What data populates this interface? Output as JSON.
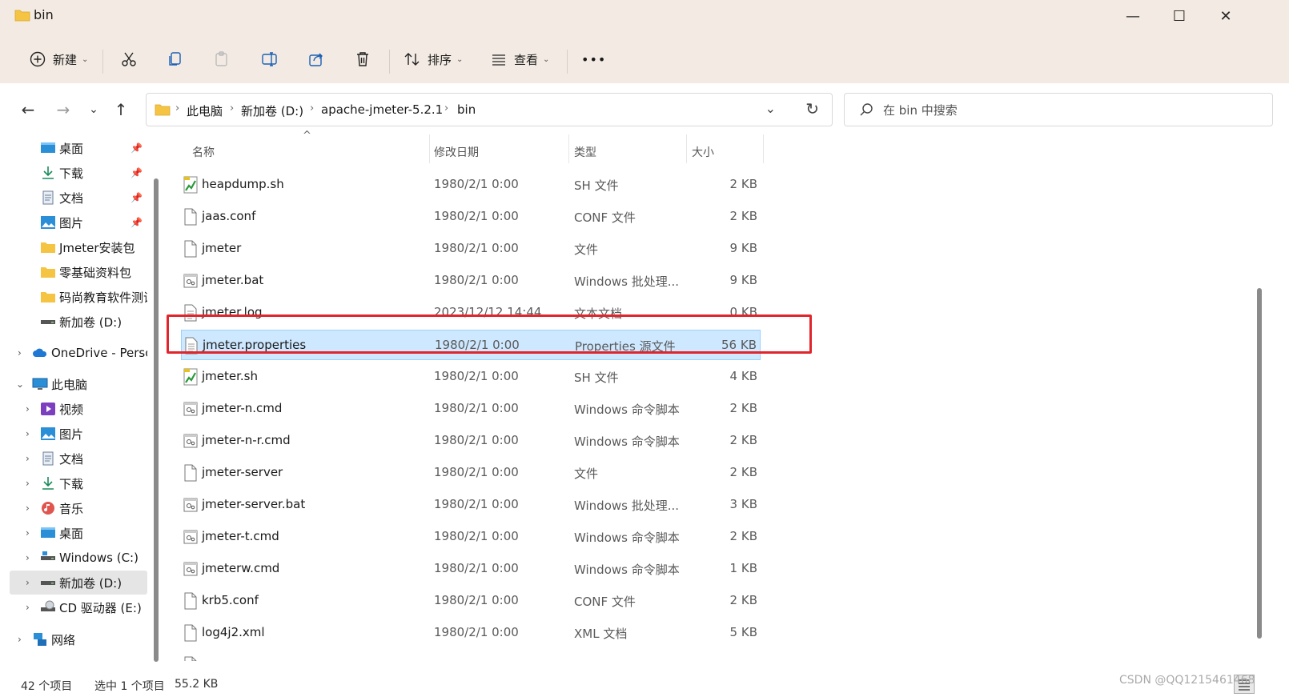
{
  "window": {
    "title": "bin",
    "minimize_glyph": "—",
    "maximize_glyph": "☐",
    "close_glyph": "✕"
  },
  "toolbar": {
    "new_label": "新建",
    "sort_label": "排序",
    "view_label": "查看",
    "more_label": "•••",
    "icons": [
      "add-icon",
      "cut-icon",
      "copy-icon",
      "paste-icon",
      "rename-icon",
      "share-icon",
      "delete-icon",
      "sort-icon",
      "view-icon",
      "more-icon"
    ]
  },
  "nav": {
    "back": "←",
    "forward": "→",
    "recent": "⌄",
    "up": "↑"
  },
  "address": {
    "crumbs": [
      "此电脑",
      "新加卷 (D:)",
      "apache-jmeter-5.2.1",
      "bin"
    ],
    "separator": "›",
    "dropdown_glyph": "⌄",
    "refresh_glyph": "↻"
  },
  "search": {
    "placeholder": "在 bin 中搜索"
  },
  "sidebar": {
    "pinned": [
      {
        "label": "桌面",
        "icon": "desktop-icon",
        "pinned": true
      },
      {
        "label": "下载",
        "icon": "download-icon",
        "pinned": true
      },
      {
        "label": "文档",
        "icon": "document-icon",
        "pinned": true
      },
      {
        "label": "图片",
        "icon": "picture-icon",
        "pinned": true
      },
      {
        "label": "Jmeter安装包",
        "icon": "folder-icon",
        "pinned": false
      },
      {
        "label": "零基础资料包",
        "icon": "folder-icon",
        "pinned": false
      },
      {
        "label": "码尚教育软件测试",
        "icon": "folder-icon",
        "pinned": false
      },
      {
        "label": "新加卷 (D:)",
        "icon": "drive-icon",
        "pinned": false
      }
    ],
    "onedrive": "OneDrive - Personal",
    "this_pc": "此电脑",
    "pc_items": [
      {
        "label": "视频",
        "icon": "video-icon"
      },
      {
        "label": "图片",
        "icon": "picture-icon"
      },
      {
        "label": "文档",
        "icon": "document-icon"
      },
      {
        "label": "下载",
        "icon": "download-icon"
      },
      {
        "label": "音乐",
        "icon": "music-icon"
      },
      {
        "label": "桌面",
        "icon": "desktop-icon"
      },
      {
        "label": "Windows (C:)",
        "icon": "drive-icon"
      },
      {
        "label": "新加卷 (D:)",
        "icon": "drive-icon"
      },
      {
        "label": "CD 驱动器 (E:)",
        "icon": "cd-drive-icon"
      }
    ],
    "network": "网络",
    "pin_glyph": "📌",
    "expand_glyph": "›",
    "expanded_glyph": "⌄"
  },
  "columns": {
    "name": "名称",
    "date": "修改日期",
    "type": "类型",
    "size": "大小",
    "sort_glyph": "^"
  },
  "files": [
    {
      "name": "heapdump.sh",
      "date": "1980/2/1 0:00",
      "type": "SH 文件",
      "size": "2 KB",
      "icon": "shell-script-icon"
    },
    {
      "name": "jaas.conf",
      "date": "1980/2/1 0:00",
      "type": "CONF 文件",
      "size": "2 KB",
      "icon": "file-icon"
    },
    {
      "name": "jmeter",
      "date": "1980/2/1 0:00",
      "type": "文件",
      "size": "9 KB",
      "icon": "file-icon"
    },
    {
      "name": "jmeter.bat",
      "date": "1980/2/1 0:00",
      "type": "Windows 批处理...",
      "size": "9 KB",
      "icon": "batch-file-icon"
    },
    {
      "name": "jmeter.log",
      "date": "2023/12/12 14:44",
      "type": "文本文档",
      "size": "0 KB",
      "icon": "text-file-icon"
    },
    {
      "name": "jmeter.properties",
      "date": "1980/2/1 0:00",
      "type": "Properties 源文件",
      "size": "56 KB",
      "icon": "text-file-icon",
      "selected": true
    },
    {
      "name": "jmeter.sh",
      "date": "1980/2/1 0:00",
      "type": "SH 文件",
      "size": "4 KB",
      "icon": "shell-script-icon"
    },
    {
      "name": "jmeter-n.cmd",
      "date": "1980/2/1 0:00",
      "type": "Windows 命令脚本",
      "size": "2 KB",
      "icon": "batch-file-icon"
    },
    {
      "name": "jmeter-n-r.cmd",
      "date": "1980/2/1 0:00",
      "type": "Windows 命令脚本",
      "size": "2 KB",
      "icon": "batch-file-icon"
    },
    {
      "name": "jmeter-server",
      "date": "1980/2/1 0:00",
      "type": "文件",
      "size": "2 KB",
      "icon": "file-icon"
    },
    {
      "name": "jmeter-server.bat",
      "date": "1980/2/1 0:00",
      "type": "Windows 批处理...",
      "size": "3 KB",
      "icon": "batch-file-icon"
    },
    {
      "name": "jmeter-t.cmd",
      "date": "1980/2/1 0:00",
      "type": "Windows 命令脚本",
      "size": "2 KB",
      "icon": "batch-file-icon"
    },
    {
      "name": "jmeterw.cmd",
      "date": "1980/2/1 0:00",
      "type": "Windows 命令脚本",
      "size": "1 KB",
      "icon": "batch-file-icon"
    },
    {
      "name": "krb5.conf",
      "date": "1980/2/1 0:00",
      "type": "CONF 文件",
      "size": "2 KB",
      "icon": "file-icon"
    },
    {
      "name": "log4j2.xml",
      "date": "1980/2/1 0:00",
      "type": "XML 文档",
      "size": "5 KB",
      "icon": "file-icon"
    }
  ],
  "status": {
    "count": "42 个项目",
    "selected": "选中 1 个项目",
    "size": "55.2 KB"
  },
  "watermark": "CSDN @QQ1215461468",
  "colors": {
    "titlebar": "#f3ebe3",
    "selection": "#cde8ff",
    "highlight_border": "#e0262c",
    "folder": "#f6c443"
  }
}
